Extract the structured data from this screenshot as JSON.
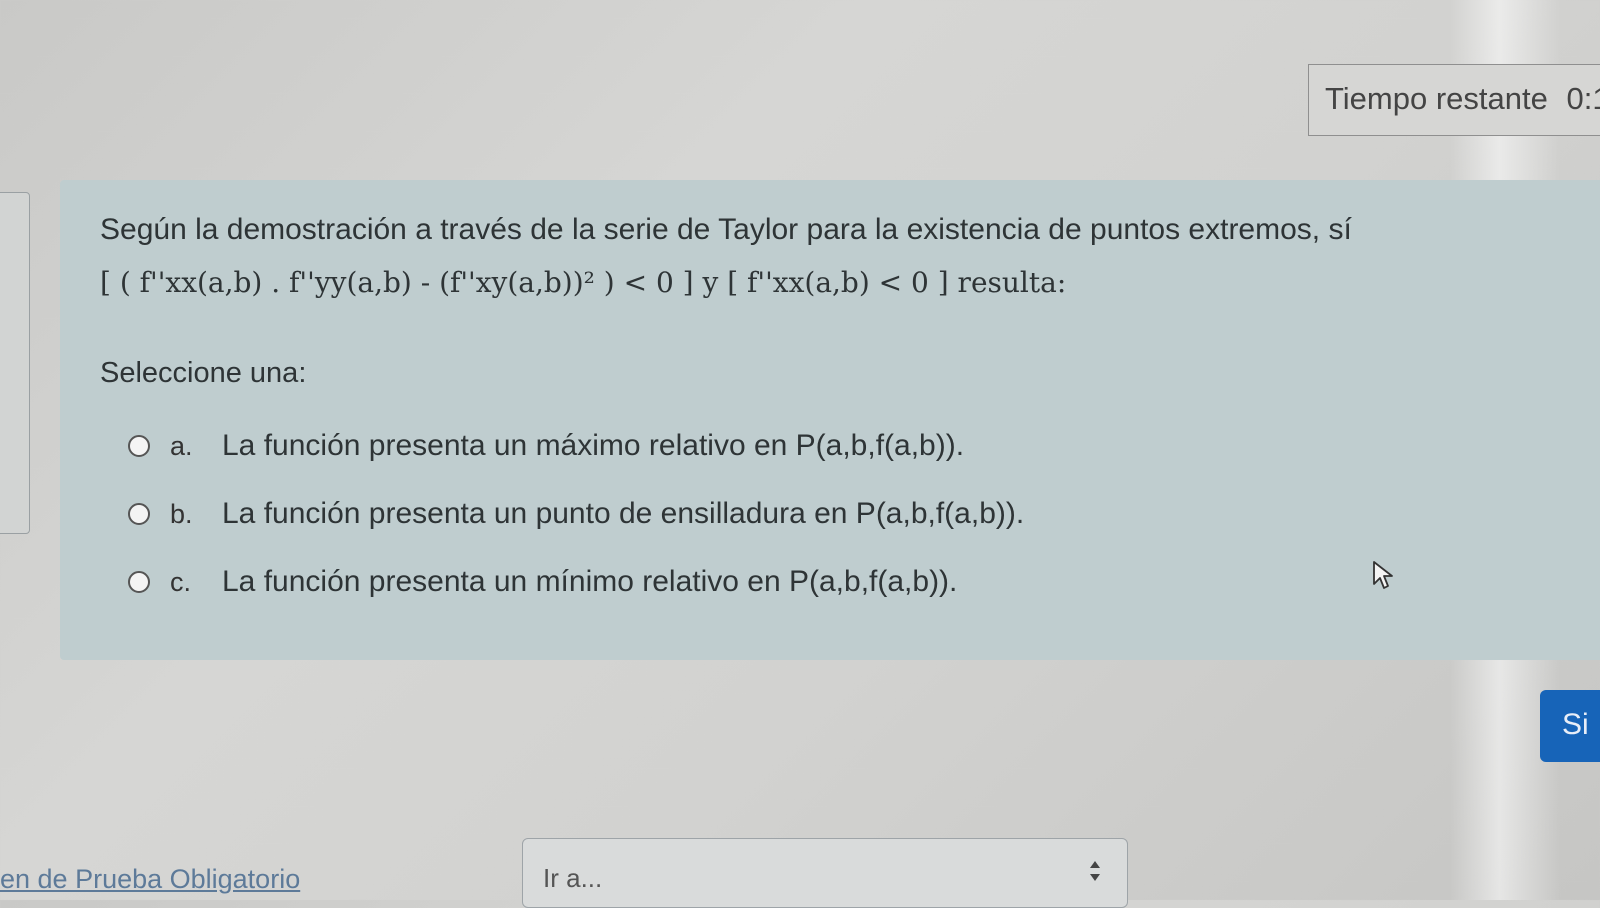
{
  "timer": {
    "label": "Tiempo restante",
    "value": "0:1"
  },
  "question": {
    "text": "Según la demostración a través de la serie de Taylor para la existencia de puntos extremos, sí",
    "formula": "[ ( f''xx(a,b) . f''yy(a,b) - (f''xy(a,b))² ) < 0 ] y [ f''xx(a,b) < 0 ] resulta:",
    "select_prompt": "Seleccione una:",
    "options": [
      {
        "letter": "a.",
        "text": "La función presenta un máximo relativo en P(a,b,f(a,b))."
      },
      {
        "letter": "b.",
        "text": "La función presenta un punto de ensilladura en P(a,b,f(a,b))."
      },
      {
        "letter": "c.",
        "text": "La función presenta un mínimo relativo en P(a,b,f(a,b))."
      }
    ]
  },
  "navigation": {
    "next_label": "Si",
    "footer_link": "en de Prueba Obligatorio",
    "jump_to": "Ir a..."
  },
  "icons": {
    "radio": "radio-unchecked-icon",
    "cursor": "mouse-pointer-icon",
    "select_arrows": "up-down-arrows-icon"
  },
  "colors": {
    "card_background": "#bfcdcf",
    "primary_button": "#1764b8",
    "link": "#5d7a99"
  }
}
